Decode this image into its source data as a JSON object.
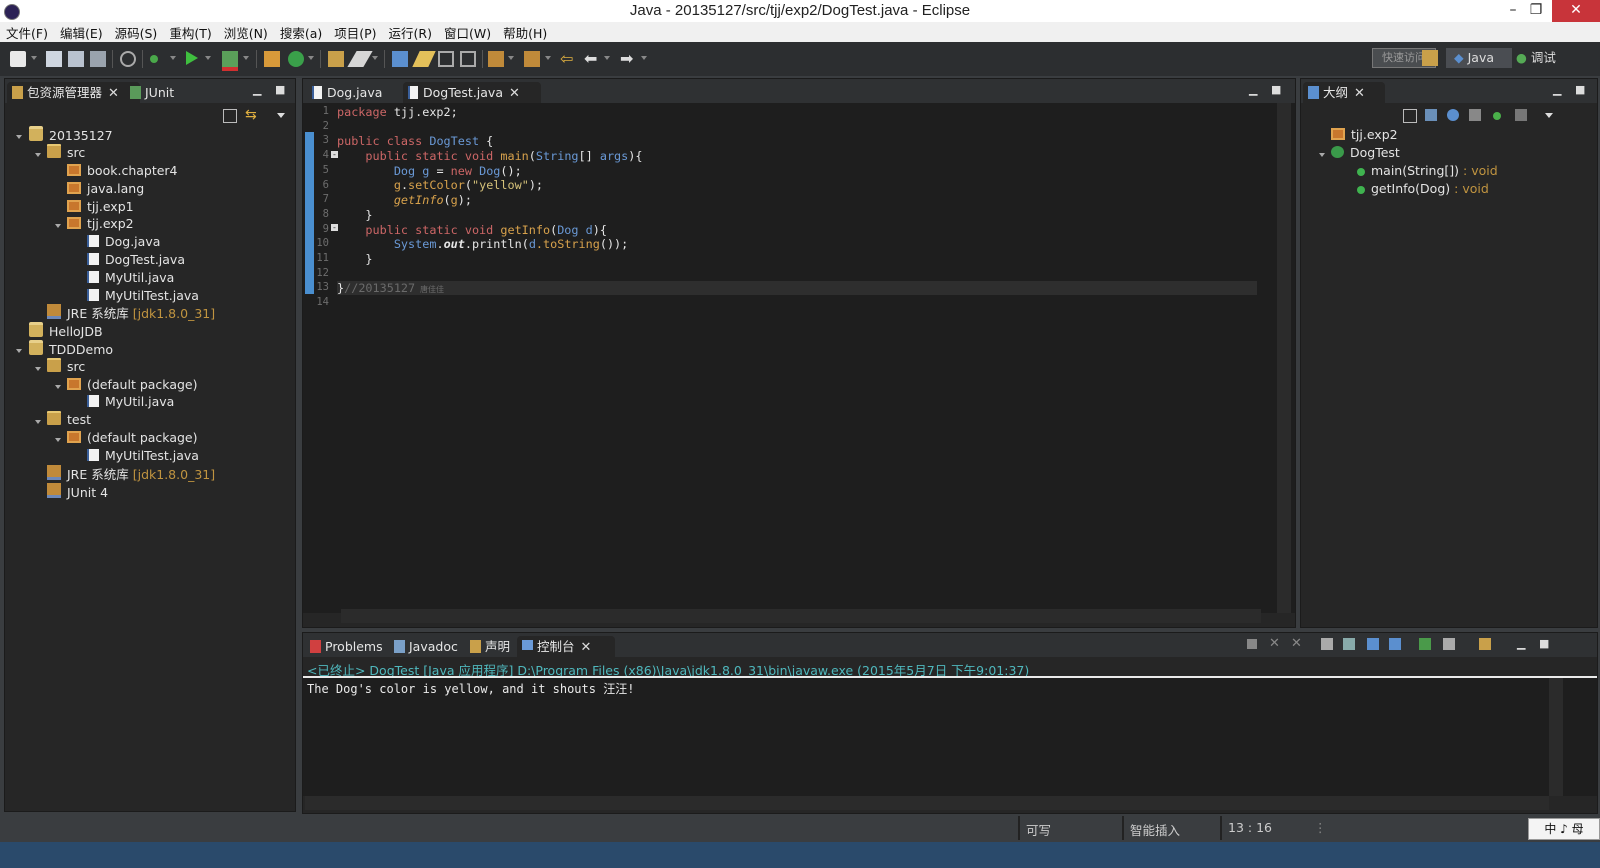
{
  "window": {
    "title": "Java - 20135127/src/tjj/exp2/DogTest.java - Eclipse"
  },
  "menu": [
    "文件(F)",
    "编辑(E)",
    "源码(S)",
    "重构(T)",
    "浏览(N)",
    "搜索(a)",
    "项目(P)",
    "运行(R)",
    "窗口(W)",
    "帮助(H)"
  ],
  "toolbar": {
    "quick_access": "快速访问",
    "persp_java": "Java",
    "persp_debug": "调试"
  },
  "explorer": {
    "tab_label": "包资源管理器",
    "junit_tab": "JUnit",
    "tree": [
      {
        "label": "20135127",
        "icon": "project-icon"
      },
      {
        "label": "src",
        "icon": "source-folder-icon"
      },
      {
        "label": "book.chapter4",
        "icon": "package-icon"
      },
      {
        "label": "java.lang",
        "icon": "package-icon"
      },
      {
        "label": "tjj.exp1",
        "icon": "package-icon"
      },
      {
        "label": "tjj.exp2",
        "icon": "package-icon"
      },
      {
        "label": "Dog.java",
        "icon": "java-file-icon"
      },
      {
        "label": "DogTest.java",
        "icon": "java-file-icon"
      },
      {
        "label": "MyUtil.java",
        "icon": "java-file-icon"
      },
      {
        "label": "MyUtilTest.java",
        "icon": "java-file-icon"
      },
      {
        "label": "JRE 系统库",
        "deco": "[jdk1.8.0_31]",
        "icon": "library-icon"
      },
      {
        "label": "HelloJDB",
        "icon": "project-icon"
      },
      {
        "label": "TDDDemo",
        "icon": "project-icon"
      },
      {
        "label": "src",
        "icon": "source-folder-icon"
      },
      {
        "label": "(default package)",
        "icon": "package-icon"
      },
      {
        "label": "MyUtil.java",
        "icon": "java-file-icon"
      },
      {
        "label": "test",
        "icon": "source-folder-icon"
      },
      {
        "label": "(default package)",
        "icon": "package-icon"
      },
      {
        "label": "MyUtilTest.java",
        "icon": "java-file-icon"
      },
      {
        "label": "JRE 系统库",
        "deco": "[jdk1.8.0_31]",
        "icon": "library-icon"
      },
      {
        "label": "JUnit 4",
        "icon": "library-icon"
      }
    ]
  },
  "editor": {
    "tabs": [
      "Dog.java",
      "DogTest.java"
    ],
    "line_numbers": [
      "1",
      "2",
      "3",
      "4",
      "5",
      "6",
      "7",
      "8",
      "9",
      "10",
      "11",
      "12",
      "13",
      "14"
    ],
    "code": {
      "l1_kw": "package",
      "l1_rest": " tjj.exp2;",
      "l3_kw": "public class",
      "l3_cls": "DogTest",
      "l3_rest": " {",
      "l4_kw": "public static void",
      "l4_fn": "main",
      "l4_p1": "(",
      "l4_ty": "String",
      "l4_p2": "[] ",
      "l4_arg": "args",
      "l4_p3": "){",
      "l5_ty": "Dog",
      "l5_var": " g ",
      "l5_eq": "= ",
      "l5_kw": "new",
      "l5_ty2": " Dog",
      "l5_end": "();",
      "l6_var": "g",
      "l6_dot": ".",
      "l6_fn": "setColor",
      "l6_p1": "(",
      "l6_str": "\"yellow\"",
      "l6_p2": ");",
      "l7_fn": "getInfo",
      "l7_p1": "(",
      "l7_var": "g",
      "l7_p2": ");",
      "l8": "}",
      "l9_kw": "public static void",
      "l9_fn": "getInfo",
      "l9_p1": "(",
      "l9_ty": "Dog",
      "l9_arg": " d",
      "l9_p2": "){",
      "l10_ty": "System",
      "l10_dot": ".",
      "l10_out": "out",
      "l10_fn": ".println",
      "l10_p1": "(",
      "l10_var": "d",
      "l10_fn2": ".toString",
      "l10_p2": "());",
      "l11": "}",
      "l13_brace": "}",
      "l13_cm": "//20135127",
      "l13_cm2": " 唐佳佳"
    }
  },
  "outline": {
    "tab_label": "大纲",
    "items": [
      {
        "label": "tjj.exp2"
      },
      {
        "label": "DogTest"
      },
      {
        "label": "main(String[])",
        "type": " : void"
      },
      {
        "label": "getInfo(Dog)",
        "type": " : void"
      }
    ]
  },
  "bottom": {
    "tabs": [
      "Problems",
      "Javadoc",
      "声明",
      "控制台"
    ],
    "console_header": "<已终止> DogTest [Java 应用程序] D:\\Program Files (x86)\\Java\\jdk1.8.0_31\\bin\\javaw.exe (2015年5月7日 下午9:01:37)",
    "console_output": "The Dog's color is yellow, and it shouts 汪汪!"
  },
  "status": {
    "writable": "可写",
    "insert_mode": "智能插入",
    "position": "13 : 16"
  },
  "ime": "中 ♪ ⺟",
  "colors": {
    "keyword": "#cc6666",
    "type": "#6a99d6",
    "method": "#d8a24c",
    "string": "#d6c27a",
    "console_link": "#4fb8bd"
  }
}
